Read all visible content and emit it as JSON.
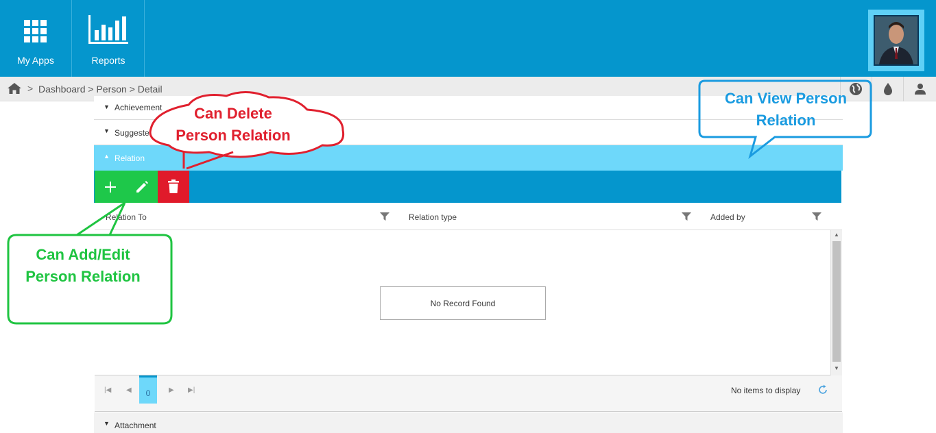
{
  "topbar": {
    "my_apps_label": "My Apps",
    "reports_label": "Reports"
  },
  "breadcrumb": {
    "separator": ">",
    "items": [
      "Dashboard",
      "Person",
      "Detail"
    ],
    "text": "Dashboard > Person > Detail"
  },
  "sections": {
    "achievement": "Achievement",
    "suggested_training": "Suggested Training",
    "relation": "Relation",
    "attachment": "Attachment"
  },
  "grid": {
    "columns": [
      "Relation To",
      "Relation type",
      "Added by"
    ],
    "empty_message": "No Record Found"
  },
  "pager": {
    "current_page": "0",
    "info": "No items to display"
  },
  "annotations": {
    "delete_line1": "Can Delete",
    "delete_line2": "Person Relation",
    "view_line1": "Can View Person",
    "view_line2": "Relation",
    "add_edit_line1": "Can Add/Edit",
    "add_edit_line2": "Person Relation"
  },
  "colors": {
    "brand_blue": "#0596cd",
    "relation_highlight": "#6ed8fa",
    "add_green": "#1ec84a",
    "delete_red": "#e01a2a",
    "delete_callout": "#e0202e",
    "view_callout": "#1a9be0",
    "add_callout": "#1fc441"
  }
}
